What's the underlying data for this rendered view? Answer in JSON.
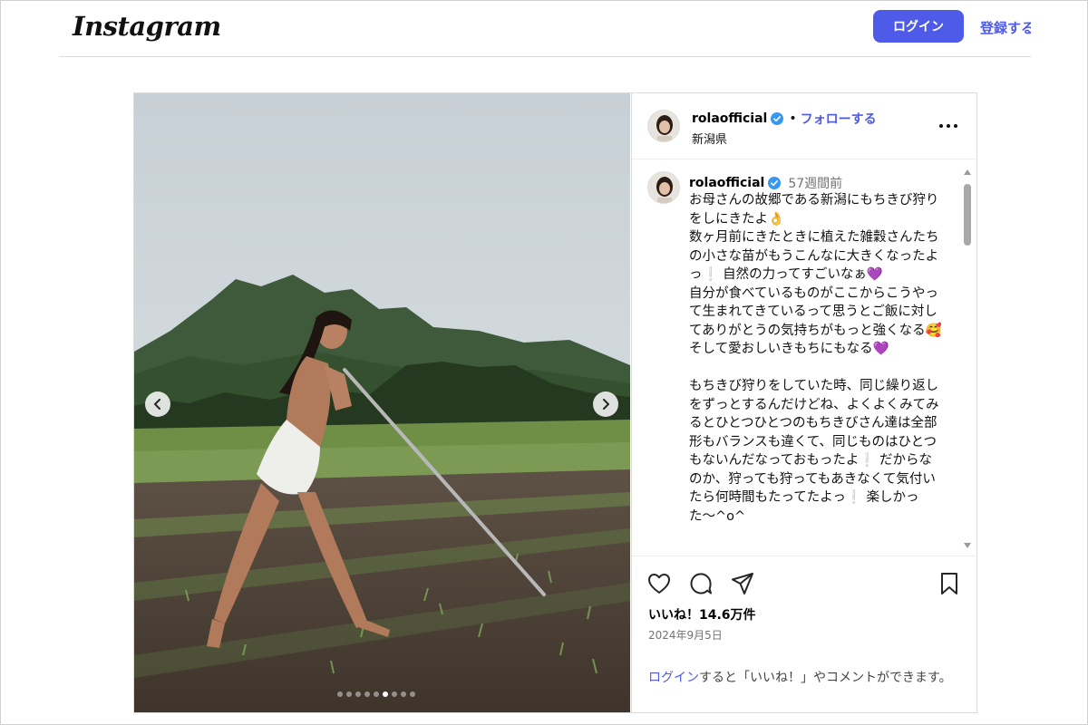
{
  "header": {
    "logo_text": "Instagram",
    "login_label": "ログイン",
    "signup_label": "登録する"
  },
  "post": {
    "username": "rolaofficial",
    "follow_separator": "•",
    "follow_label": "フォローする",
    "location": "新潟県",
    "carousel": {
      "total_slides": 9,
      "active_slide": 6
    },
    "caption": {
      "username": "rolaofficial",
      "time_ago": "57週間前",
      "text": "お母さんの故郷である新潟にもちきび狩りをしにきたよ👌\n数ヶ月前にきたときに植えた雑穀さんたちの小さな苗がもうこんなに大きくなったよっ❕ 自然の力ってすごいなぁ💜\n自分が食べているものがここからこうやって生まれてきているって思うとご飯に対してありがとうの気持ちがもっと強くなる🥰 そして愛おしいきもちにもなる💜\n\nもちきび狩りをしていた時、同じ繰り返しをずっとするんだけどね、よくよくみてみるとひとつひとつのもちきびさん達は全部形もバランスも違くて、同じものはひとつもないんだなっておもったよ❕ だからなのか、狩っても狩ってもあきなくて気付いたら何時間もたってたよっ❕ 楽しかった〜^o^"
    },
    "likes_text": "いいね！14.6万件",
    "date": "2024年9月5日",
    "login_prompt": {
      "link_text": "ログイン",
      "rest_text": "すると「いいね！」やコメントができます。"
    }
  },
  "icons": {
    "like": "heart-outline-icon",
    "comment": "speech-bubble-icon",
    "share": "paper-plane-icon",
    "save": "bookmark-outline-icon",
    "verified": "verified-badge-icon",
    "more": "more-horizontal-icon",
    "prev": "chevron-left-icon",
    "next": "chevron-right-icon"
  },
  "colors": {
    "accent": "#4e5ae8",
    "verified": "#3897f0",
    "border": "#dbdbdb",
    "muted": "#737373"
  }
}
